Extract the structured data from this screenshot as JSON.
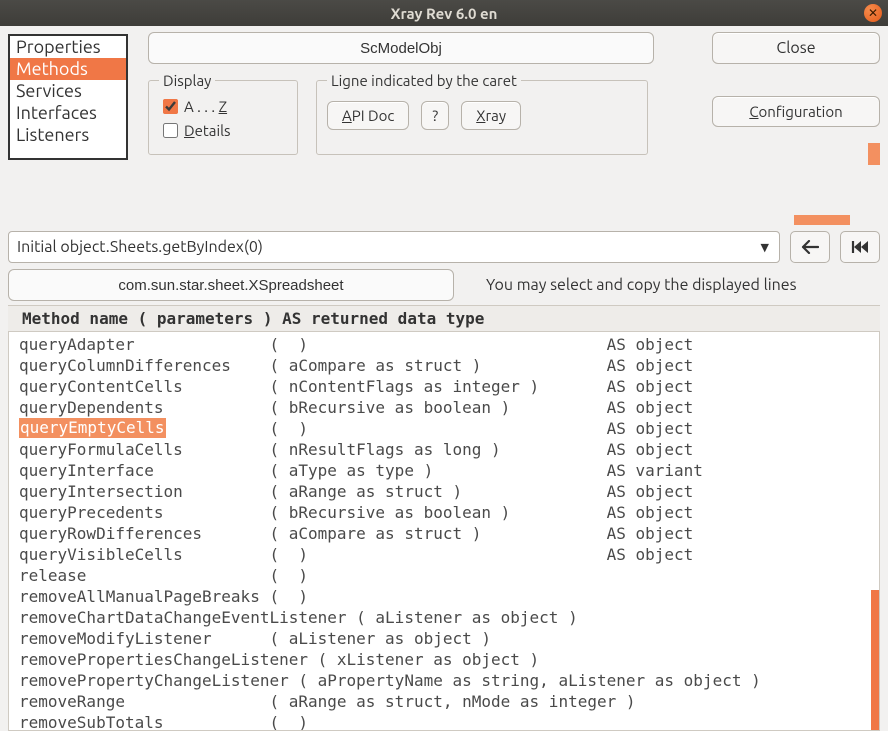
{
  "window": {
    "title": "Xray   Rev 6.0 en"
  },
  "categories": [
    "Properties",
    "Methods",
    "Services",
    "Interfaces",
    "Listeners"
  ],
  "selected_category_index": 1,
  "object_field": "ScModelObj",
  "buttons": {
    "close": "Close",
    "configuration": "Configuration",
    "api_doc": "API Doc",
    "question": "?",
    "xray": "Xray",
    "back": "🡐",
    "rewind": "⏮"
  },
  "display_group": {
    "legend": "Display",
    "az_checked": true,
    "az_label_pre": "A . . . ",
    "az_label_u": "Z",
    "details_checked": false,
    "details_label_u": "D",
    "details_label_rest": "etails"
  },
  "caret_group": {
    "legend": "Ligne indicated by the caret",
    "api_u": "A",
    "api_rest": "PI Doc",
    "xray_u": "X",
    "xray_rest": "ray"
  },
  "config_u": "C",
  "config_rest": "onfiguration",
  "path_combo": "Initial object.Sheets.getByIndex(0)",
  "interface_field": "com.sun.star.sheet.XSpreadsheet",
  "hint": "You may select and copy the displayed lines",
  "list_header": " Method name              (  parameters  )                  AS  returned data type",
  "highlight_text": "queryEmptyCells",
  "list_body": "queryAdapter              (  )                               AS object\nqueryColumnDifferences    ( aCompare as struct )             AS object\nqueryContentCells         ( nContentFlags as integer )       AS object\nqueryDependents           ( bRecursive as boolean )          AS object\nqueryEmptyCells           (  )                               AS object\nqueryFormulaCells         ( nResultFlags as long )           AS object\nqueryInterface            ( aType as type )                  AS variant\nqueryIntersection         ( aRange as struct )               AS object\nqueryPrecedents           ( bRecursive as boolean )          AS object\nqueryRowDifferences       ( aCompare as struct )             AS object\nqueryVisibleCells         (  )                               AS object\nrelease                   (  ) \nremoveAllManualPageBreaks (  ) \nremoveChartDataChangeEventListener ( aListener as object ) \nremoveModifyListener      ( aListener as object ) \nremovePropertiesChangeListener ( xListener as object ) \nremovePropertyChangeListener ( aPropertyName as string, aListener as object ) \nremoveRange               ( aRange as struct, nMode as integer ) \nremoveSubTotals           (  ) "
}
